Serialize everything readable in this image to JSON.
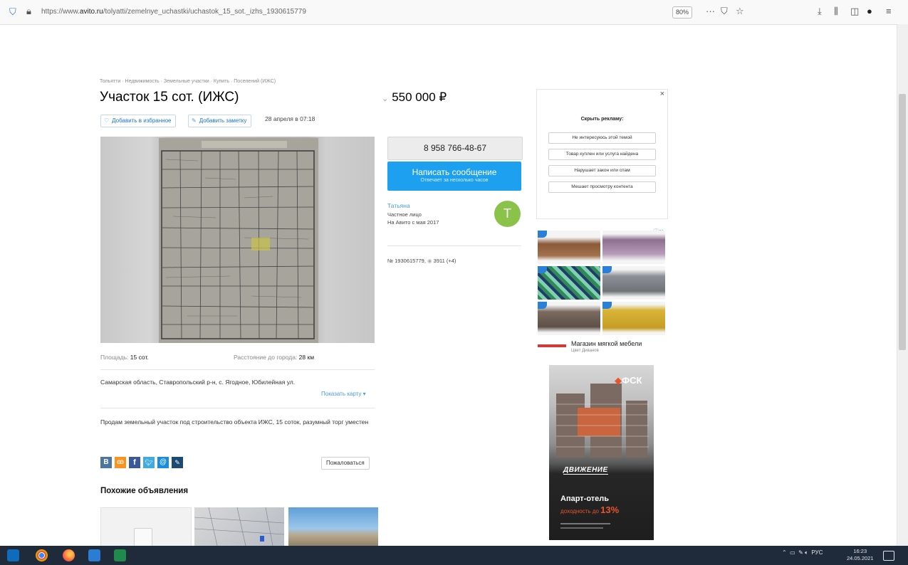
{
  "browser": {
    "url_prefix": "https://www.",
    "url_domain": "avito.ru",
    "url_path": "/tolyatti/zemelnye_uchastki/uchastok_15_sot._izhs_1930615779",
    "zoom": "80%",
    "more_label": "···"
  },
  "listing": {
    "breadcrumb": "Тольятти · Недвижимость · Земельные участки · Купить · Поселений (ИЖС)",
    "title": "Участок 15 сот. (ИЖС)",
    "price": "550 000 ₽",
    "favorite_label": "Добавить в избранное",
    "note_label": "Добавить заметку",
    "date": "28 апреля в 07:18",
    "area_label": "Площадь:",
    "area_value": "15 сот.",
    "distance_label": "Расстояние до города:",
    "distance_value": "28 км",
    "address": "Самарская область, Ставропольский р-н, с. Ягодное, Юбилейная ул.",
    "show_map": "Показать карту",
    "description": "Продам земельный участок под строительство объекта ИЖС, 15 соток, разумный торг уместен",
    "report_label": "Пожаловаться",
    "similar_heading": "Похожие объявления",
    "share_icons": [
      "vk-icon",
      "ok-icon",
      "facebook-icon",
      "twitter-icon",
      "mail-icon",
      "lj-icon"
    ]
  },
  "seller": {
    "phone": "8 958 766-48-67",
    "message_label": "Написать сообщение",
    "message_sub": "Отвечает за несколько часов",
    "name": "Татьяна",
    "type": "Частное лицо",
    "since": "На Авито с мая 2017",
    "avatar_letter": "Т",
    "listing_id": "№ 1930615779,",
    "views": "3911 (+4)"
  },
  "ads": {
    "hide_title": "Скрыть рекламу:",
    "close": "×",
    "options": [
      "Не интересуюсь этой темой",
      "Товар куплен или услуга найдена",
      "Нарушает закон или спам",
      "Мешает просмотру контента"
    ],
    "furniture_store": "Магазин мягкой мебели",
    "furniture_sub": "Цвет Диванов",
    "banner_brand": "ФСК",
    "banner_project": "ДВИЖЕНИЕ",
    "banner_line1": "Апарт-отель",
    "banner_line2": "доходность до",
    "banner_percent": "13%"
  },
  "taskbar": {
    "lang": "РУС",
    "time": "16:23",
    "date": "24.05.2021"
  },
  "colors": {
    "accent_blue": "#1ea0f0",
    "link_blue": "#4a9be0",
    "avatar_green": "#8bc34a"
  }
}
